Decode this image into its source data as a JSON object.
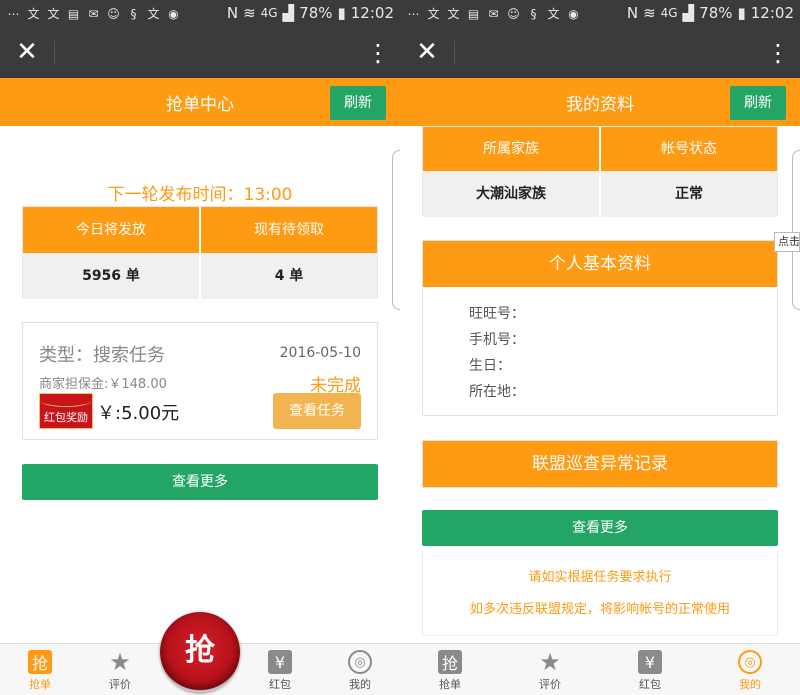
{
  "status_bar": {
    "battery": "78%",
    "time": "12:02",
    "network": "4G",
    "left_icons": [
      "sohu-icon",
      "text-icon",
      "text-icon",
      "news-icon",
      "mail-icon",
      "chat-icon",
      "stock-icon",
      "text-icon",
      "camera-icon"
    ]
  },
  "left_screen": {
    "header_title": "抢单中心",
    "refresh_label": "刷新",
    "next_round": "下一轮发布时间：13:00",
    "stats": {
      "headers": [
        "今日将发放",
        "现有待领取"
      ],
      "values": [
        "5956 单",
        "4 单"
      ]
    },
    "task": {
      "type": "类型：搜索任务",
      "date": "2016-05-10",
      "deposit": "商家担保金:￥148.00",
      "status": "未完成",
      "redpacket_label": "红包奖励",
      "reward": "￥:5.00元",
      "view_button": "查看任务"
    },
    "more_button": "查看更多",
    "grab_button": "抢"
  },
  "right_screen": {
    "header_title": "我的资料",
    "refresh_label": "刷新",
    "family": {
      "headers": [
        "所属家族",
        "帐号状态"
      ],
      "values": [
        "大潮汕家族",
        "正常"
      ]
    },
    "profile": {
      "title": "个人基本资料",
      "fields": [
        "旺旺号：",
        "手机号：",
        "生日：",
        "所在地："
      ]
    },
    "alliance_title": "联盟巡查异常记录",
    "more_button": "查看更多",
    "notices": [
      "请如实根据任务要求执行",
      "如多次违反联盟规定，将影响帐号的正常使用"
    ],
    "side_tooltip": "点击"
  },
  "tabbar": {
    "tabs": [
      {
        "label": "抢单",
        "glyph": "抢"
      },
      {
        "label": "评价",
        "glyph": "★"
      },
      {
        "label": "红包",
        "glyph": "¥"
      },
      {
        "label": "我的",
        "glyph": "◎"
      }
    ]
  },
  "colors": {
    "orange": "#ff9a13",
    "green": "#22a565",
    "dark_bar": "#3a3b3d"
  }
}
